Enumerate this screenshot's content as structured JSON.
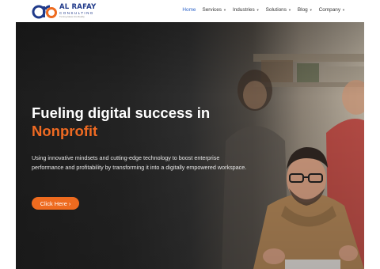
{
  "brand": {
    "name": "AL RAFAY",
    "subtitle": "CONSULTING",
    "tagline": "Turning Ideas Into Reality",
    "colors": {
      "primary": "#203a8a",
      "accent": "#ee6b1f"
    }
  },
  "nav": {
    "items": [
      {
        "label": "Home",
        "dropdown": false,
        "active": true
      },
      {
        "label": "Services",
        "dropdown": true,
        "active": false
      },
      {
        "label": "Industries",
        "dropdown": true,
        "active": false
      },
      {
        "label": "Solutions",
        "dropdown": true,
        "active": false
      },
      {
        "label": "Blog",
        "dropdown": true,
        "active": false
      },
      {
        "label": "Company",
        "dropdown": true,
        "active": false
      }
    ],
    "caret_icon": "chevron-down-icon"
  },
  "hero": {
    "headline": "Fueling digital success in",
    "headline_accent": "Nonprofit",
    "description": "Using innovative mindsets and cutting-edge technology to boost enterprise performance and profitability by transforming it into a digitally empowered workspace.",
    "cta_label": "Click Here",
    "cta_icon": "chevron-right-icon"
  }
}
